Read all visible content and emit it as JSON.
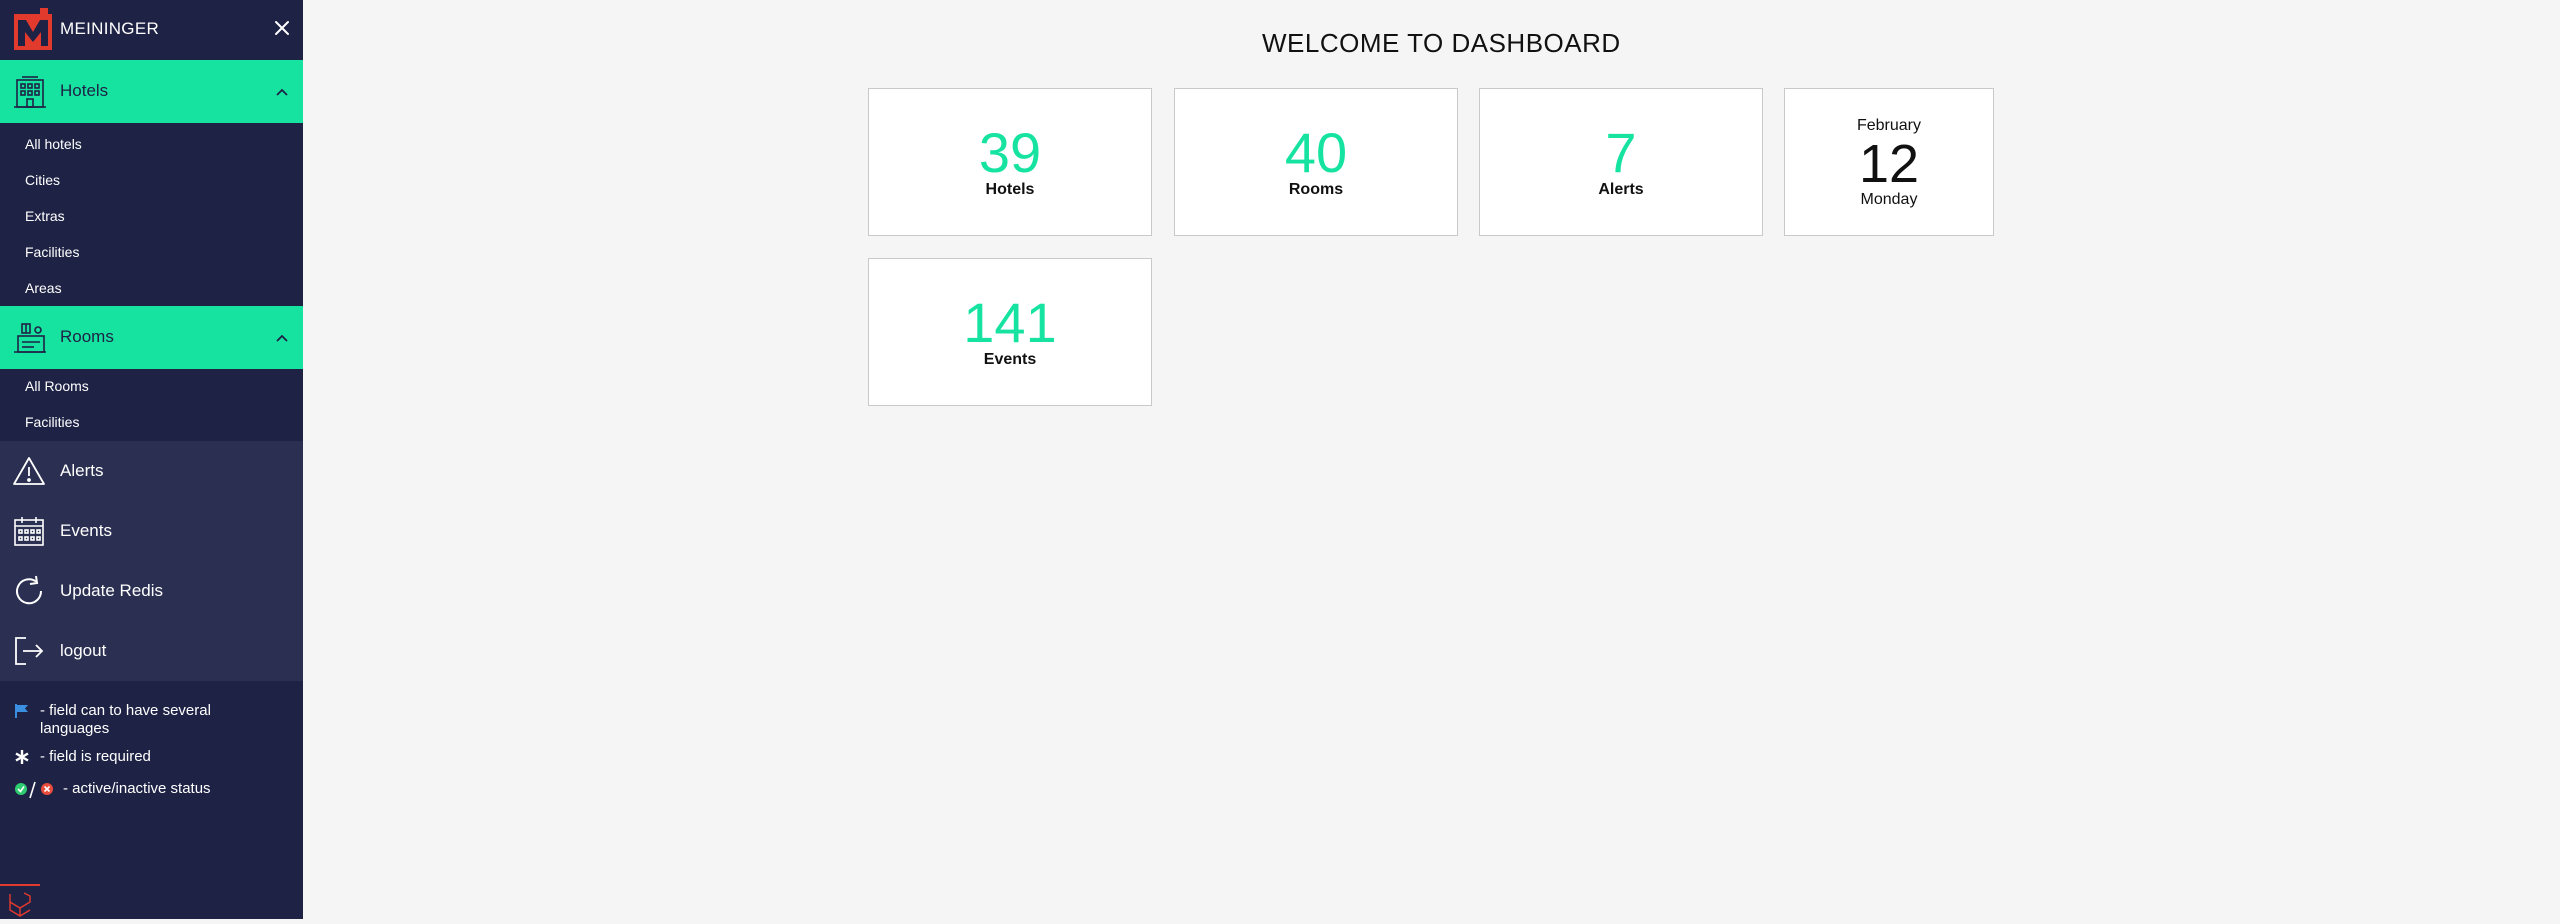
{
  "brand": {
    "name": "MEININGER"
  },
  "sidebar": {
    "hotels": {
      "label": "Hotels",
      "items": [
        "All hotels",
        "Cities",
        "Extras",
        "Facilities",
        "Areas"
      ]
    },
    "rooms": {
      "label": "Rooms",
      "items": [
        "All Rooms",
        "Facilities"
      ]
    },
    "nav": [
      {
        "label": "Alerts",
        "icon": "warning-icon"
      },
      {
        "label": "Events",
        "icon": "calendar-icon"
      },
      {
        "label": "Update Redis",
        "icon": "refresh-icon"
      },
      {
        "label": "logout",
        "icon": "logout-icon"
      }
    ],
    "legend": [
      {
        "icon": "flag-icon",
        "text": "- field can to have several languages"
      },
      {
        "icon": "asterisk-icon",
        "text": "- field is required"
      },
      {
        "icon": "status-icon",
        "text": "- active/inactive status"
      }
    ]
  },
  "main": {
    "title": "WELCOME TO DASHBOARD",
    "stats": [
      {
        "value": "39",
        "label": "Hotels"
      },
      {
        "value": "40",
        "label": "Rooms"
      },
      {
        "value": "7",
        "label": "Alerts"
      },
      {
        "value": "141",
        "label": "Events"
      }
    ],
    "date": {
      "month": "February",
      "day": "12",
      "weekday": "Monday"
    }
  },
  "colors": {
    "accent": "#17e3a1",
    "sidebar": "#1e2245",
    "sidebar_nav": "#2b3052",
    "brand_red": "#e33a2e"
  }
}
